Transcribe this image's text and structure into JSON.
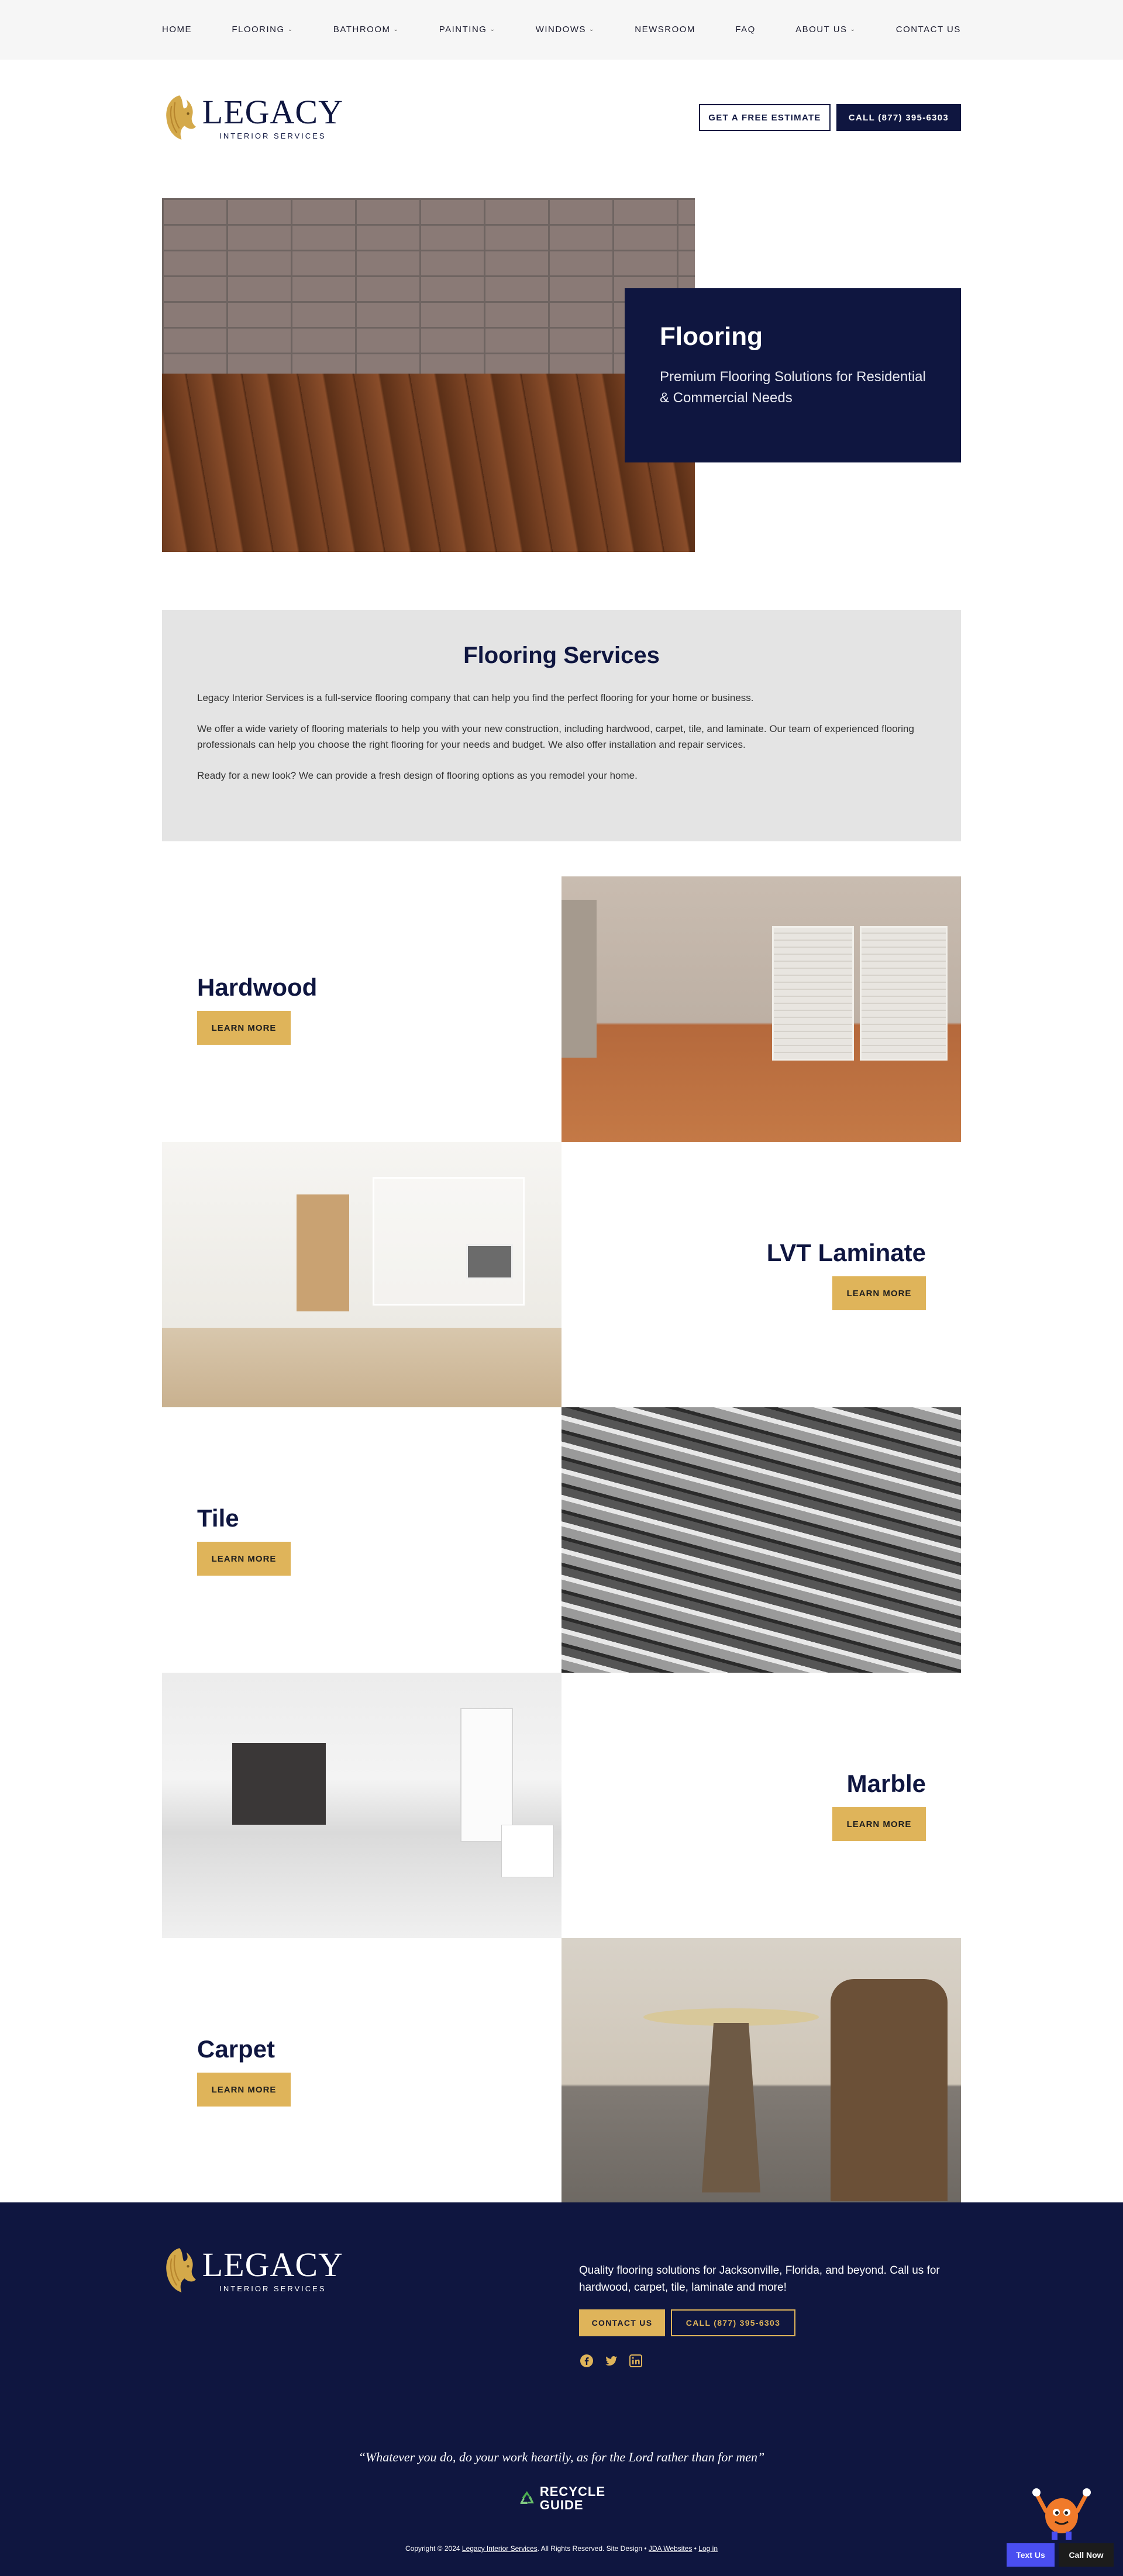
{
  "nav": {
    "items": [
      {
        "label": "HOME",
        "has_caret": false
      },
      {
        "label": "FLOORING",
        "has_caret": true
      },
      {
        "label": "BATHROOM",
        "has_caret": true
      },
      {
        "label": "PAINTING",
        "has_caret": true
      },
      {
        "label": "WINDOWS",
        "has_caret": true
      },
      {
        "label": "NEWSROOM",
        "has_caret": false
      },
      {
        "label": "FAQ",
        "has_caret": false
      },
      {
        "label": "ABOUT US",
        "has_caret": true
      },
      {
        "label": "CONTACT US",
        "has_caret": false
      }
    ],
    "caret": "⌄"
  },
  "brand": {
    "name": "LEGACY",
    "tagline": "INTERIOR SERVICES",
    "colors": {
      "navy": "#0f1640",
      "gold": "#dfb45a"
    }
  },
  "header": {
    "estimate_label": "GET A FREE ESTIMATE",
    "call_label": "CALL (877) 395-6303"
  },
  "hero": {
    "title": "Flooring",
    "subtitle": "Premium Flooring Solutions for Residential & Commercial Needs"
  },
  "services": {
    "title": "Flooring Services",
    "paragraphs": [
      "Legacy Interior Services is a full-service flooring company that can help you find the perfect flooring for your home or business.",
      "We offer a wide variety of flooring materials to help you with your new construction, including hardwood, carpet, tile, and laminate. Our team of experienced flooring professionals can help you choose the right flooring for your needs and budget. We also offer installation and repair services.",
      "Ready for a new look? We can provide a fresh design of flooring options as you remodel your home."
    ]
  },
  "features": {
    "learn_more": "LEARN MORE",
    "items": [
      {
        "title": "Hardwood"
      },
      {
        "title": "LVT Laminate"
      },
      {
        "title": "Tile"
      },
      {
        "title": "Marble"
      },
      {
        "title": "Carpet"
      }
    ]
  },
  "footer": {
    "tagline": "Quality flooring solutions for Jacksonville, Florida, and beyond. Call us for hardwood, carpet, tile, laminate and more!",
    "contact_label": "CONTACT US",
    "call_label": "CALL (877) 395-6303",
    "social": [
      "facebook-icon",
      "twitter-icon",
      "linkedin-icon"
    ],
    "quote": "“Whatever you do, do your work heartily, as for the Lord rather than for men”",
    "recycle_line1": "RECYCLE",
    "recycle_line2": "GUIDE",
    "copyright_prefix": "Copyright © 2024",
    "copyright_company": "Legacy Interior Services",
    "copyright_mid": ". All Rights Reserved. Site Design •",
    "copyright_designer": "JDA Websites",
    "copyright_sep": "•",
    "copyright_login": "Log in"
  },
  "floating": {
    "text_us": "Text Us",
    "call_now": "Call Now"
  }
}
